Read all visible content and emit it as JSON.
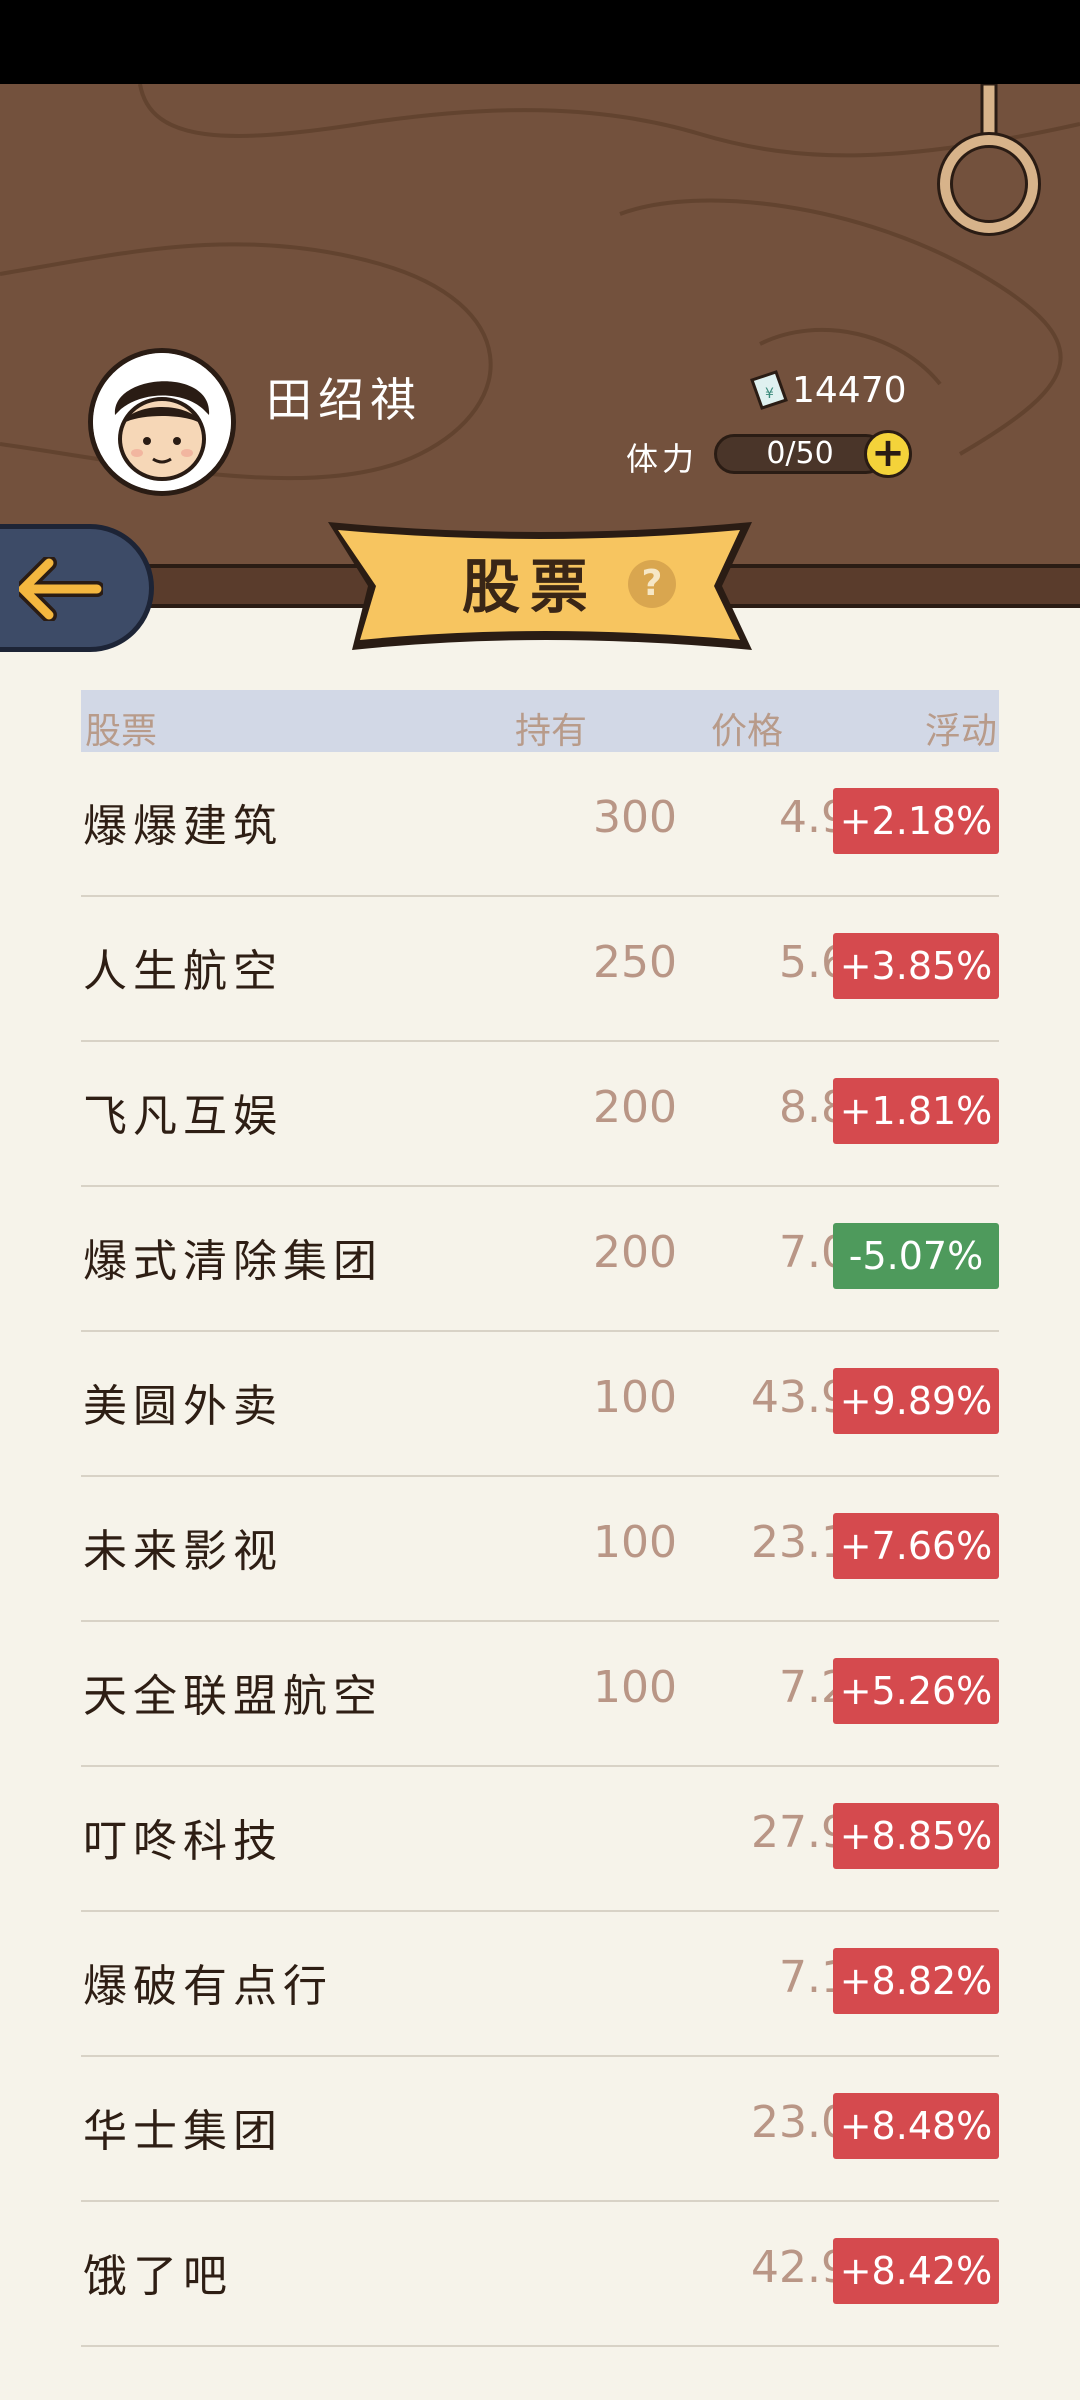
{
  "player": {
    "name": "田绍祺",
    "money": "14470",
    "stamina_label": "体力",
    "stamina": "0/50"
  },
  "page": {
    "title": "股票",
    "help": "?"
  },
  "table": {
    "headers": {
      "name": "股票",
      "held": "持有",
      "price": "价格",
      "change": "浮动"
    },
    "rows": [
      {
        "name": "爆爆建筑",
        "held": "300",
        "price": "4.96",
        "change": "+2.18%",
        "trend": "up"
      },
      {
        "name": "人生航空",
        "held": "250",
        "price": "5.69",
        "change": "+3.85%",
        "trend": "up"
      },
      {
        "name": "飞凡互娱",
        "held": "200",
        "price": "8.81",
        "change": "+1.81%",
        "trend": "up"
      },
      {
        "name": "爆式清除集团",
        "held": "200",
        "price": "7.08",
        "change": "-5.07%",
        "trend": "down"
      },
      {
        "name": "美圆外卖",
        "held": "100",
        "price": "43.93",
        "change": "+9.89%",
        "trend": "up"
      },
      {
        "name": "未来影视",
        "held": "100",
        "price": "23.19",
        "change": "+7.66%",
        "trend": "up"
      },
      {
        "name": "天全联盟航空",
        "held": "100",
        "price": "7.20",
        "change": "+5.26%",
        "trend": "up"
      },
      {
        "name": "叮咚科技",
        "held": "",
        "price": "27.95",
        "change": "+8.85%",
        "trend": "up"
      },
      {
        "name": "爆破有点行",
        "held": "",
        "price": "7.11",
        "change": "+8.82%",
        "trend": "up"
      },
      {
        "name": "华士集团",
        "held": "",
        "price": "23.00",
        "change": "+8.48%",
        "trend": "up"
      },
      {
        "name": "饿了吧",
        "held": "",
        "price": "42.95",
        "change": "+8.42%",
        "trend": "up"
      }
    ]
  },
  "colors": {
    "up": "#d54a4e",
    "down": "#4e9a5c",
    "wood": "#73513d",
    "paper": "#f6f3ea"
  }
}
